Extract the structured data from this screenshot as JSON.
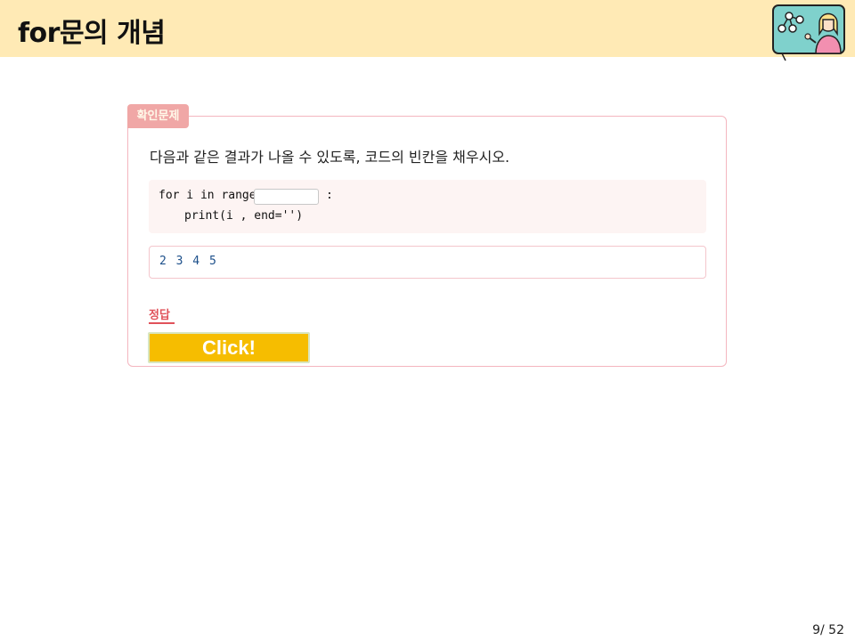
{
  "header": {
    "title": "for문의 개념",
    "colors": {
      "bar": "#ffeab5"
    }
  },
  "card": {
    "badge": "확인문제",
    "question": "다음과 같은 결과가 나올 수 있도록, 코드의 빈칸을 채우시오.",
    "code": {
      "line1_prefix": "for i in range",
      "line1_suffix": ":",
      "line2": "print(i , end='')"
    },
    "output": "2 3 4 5",
    "answer_label": "정답",
    "button_label": "Click!",
    "colors": {
      "border": "#f4b6bf",
      "badge": "#f0a7a6",
      "button": "#f6bd00"
    }
  },
  "footer": {
    "page": "9/ 52"
  }
}
